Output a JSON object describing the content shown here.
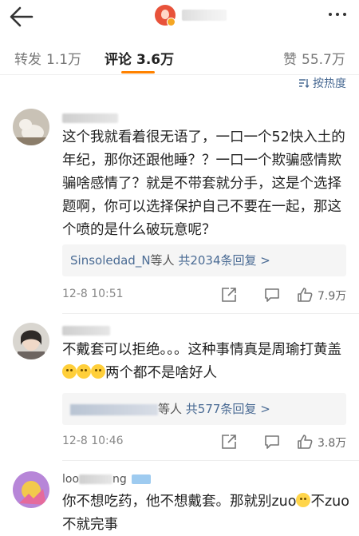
{
  "header": {
    "back_icon": "back-arrow-icon",
    "more_icon": "more-dots-icon"
  },
  "tabs": [
    {
      "label": "转发",
      "count": "1.1万"
    },
    {
      "label": "评论",
      "count": "3.6万"
    },
    {
      "label": "赞",
      "count": "55.7万"
    }
  ],
  "sort": {
    "label": "按热度",
    "icon": "sort-icon"
  },
  "comments": [
    {
      "text": "这个我就看着很无语了，一口一个52快入土的年纪，那你还跟他睡？？一口一个欺骗感情欺骗啥感情了？就是不带套就分手，这是个选择题啊，你可以选择保护自己不要在一起，那这个喷的是什么破玩意呢？",
      "reply": {
        "who": "Sinsoledad_N",
        "mid": "等人",
        "count": "共2034条回复 >"
      },
      "time": "12-8 10:51",
      "likes": "7.9万"
    },
    {
      "text_a": "不戴套可以拒绝。。。这种事情真是周瑜打黄盖",
      "text_b": "两个都不是啥好人",
      "reply": {
        "mid": "等人",
        "count": "共577条回复 >"
      },
      "time": "12-8 10:46",
      "likes": "3.8万"
    },
    {
      "name_prefix": "loo",
      "name_suffix": "ng",
      "text_a": "你不想吃药，他不想戴套。那就别zuo",
      "text_b": "不zuo不就完事"
    }
  ],
  "colors": {
    "accent": "#ff8200",
    "link": "#4a6b94",
    "text": "#222222",
    "muted": "#888888"
  }
}
